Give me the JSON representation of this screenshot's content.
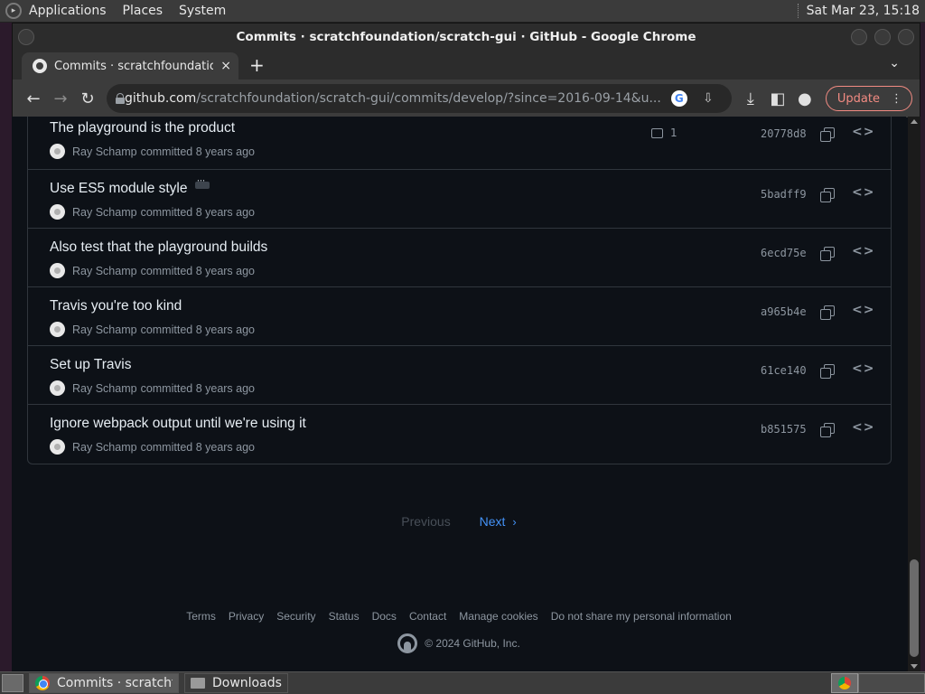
{
  "system_panel": {
    "menus": [
      "Applications",
      "Places",
      "System"
    ],
    "clock": "Sat Mar 23, 15:18"
  },
  "window": {
    "title": "Commits · scratchfoundation/scratch-gui · GitHub - Google Chrome"
  },
  "tab": {
    "title": "Commits · scratchfoundation/",
    "close_glyph": "×",
    "new_tab_glyph": "+"
  },
  "toolbar": {
    "url_host": "github.com",
    "url_path": "/scratchfoundation/scratch-gui/commits/develop/?since=2016-09-14&u...",
    "update_label": "Update"
  },
  "commits": [
    {
      "message": "The playground is the product",
      "author": "Ray Schamp",
      "meta": "committed 8 years ago",
      "comments": "1",
      "sha": "20778d8",
      "has_ellipsis": false
    },
    {
      "message": "Use ES5 module style",
      "author": "Ray Schamp",
      "meta": "committed 8 years ago",
      "comments": "",
      "sha": "5badff9",
      "has_ellipsis": true
    },
    {
      "message": "Also test that the playground builds",
      "author": "Ray Schamp",
      "meta": "committed 8 years ago",
      "comments": "",
      "sha": "6ecd75e",
      "has_ellipsis": false
    },
    {
      "message": "Travis you're too kind",
      "author": "Ray Schamp",
      "meta": "committed 8 years ago",
      "comments": "",
      "sha": "a965b4e",
      "has_ellipsis": false
    },
    {
      "message": "Set up Travis",
      "author": "Ray Schamp",
      "meta": "committed 8 years ago",
      "comments": "",
      "sha": "61ce140",
      "has_ellipsis": false
    },
    {
      "message": "Ignore webpack output until we're using it",
      "author": "Ray Schamp",
      "meta": "committed 8 years ago",
      "comments": "",
      "sha": "b851575",
      "has_ellipsis": false
    }
  ],
  "pagination": {
    "previous": "Previous",
    "next": "Next"
  },
  "footer": {
    "links": [
      "Terms",
      "Privacy",
      "Security",
      "Status",
      "Docs",
      "Contact",
      "Manage cookies",
      "Do not share my personal information"
    ],
    "copyright": "© 2024 GitHub, Inc."
  },
  "taskbar": {
    "tasks": [
      {
        "label": "Commits · scratchfo...",
        "icon": "chrome-icon",
        "active": true
      },
      {
        "label": "Downloads",
        "icon": "folder-icon",
        "active": false
      }
    ]
  },
  "colors": {
    "background": "#0d1117",
    "border": "#30363d",
    "text": "#e6edf3",
    "muted": "#8d96a0",
    "link": "#4493f8",
    "update_accent": "#f28b82"
  }
}
